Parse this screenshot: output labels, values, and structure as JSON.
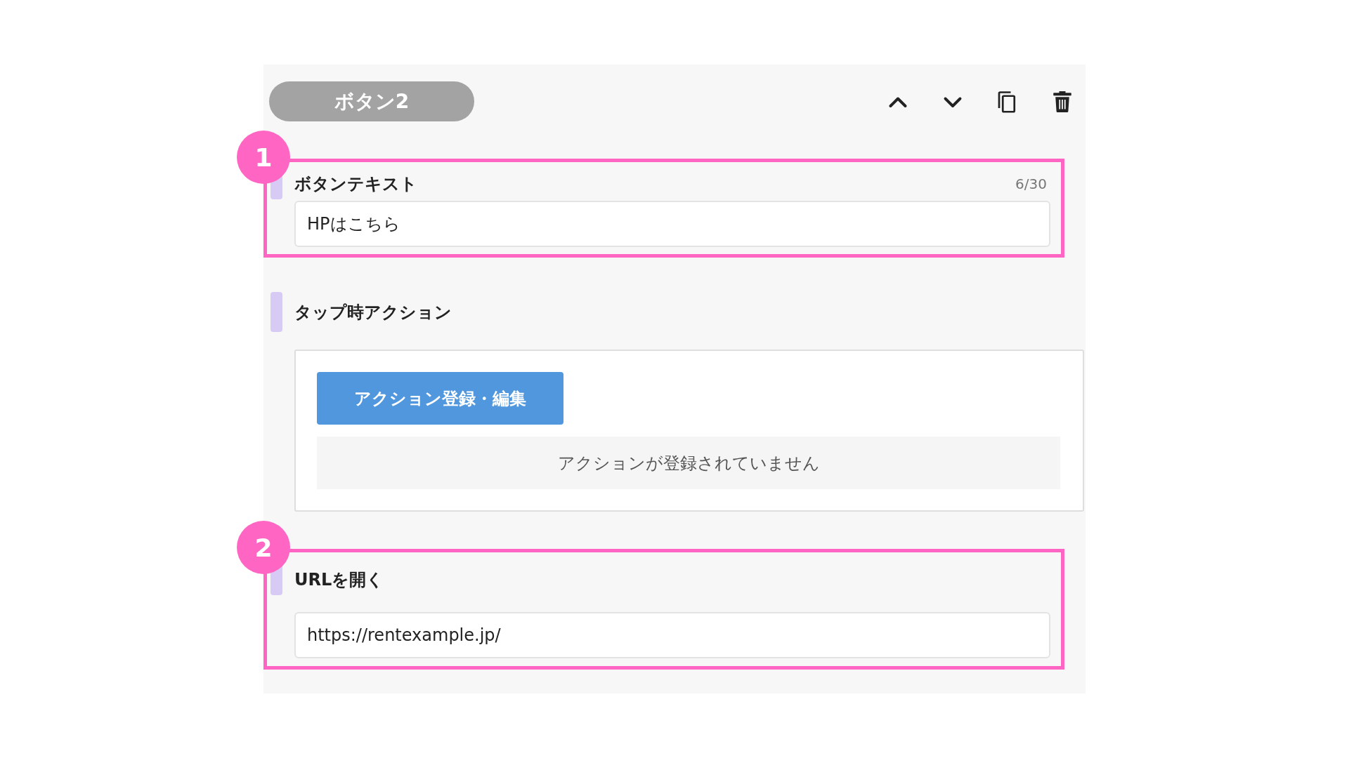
{
  "header": {
    "title": "ボタン2"
  },
  "sections": [
    {
      "kind": "text_field",
      "label": "ボタンテキスト",
      "counter": "6/30",
      "value": "HPはこちら",
      "annotation": "1"
    },
    {
      "kind": "action",
      "label": "タップ時アクション",
      "button": "アクション登録・編集",
      "empty_message": "アクションが登録されていません"
    },
    {
      "kind": "text_field",
      "label": "URLを開く",
      "value": "https://rentexample.jp/",
      "annotation": "2"
    }
  ]
}
